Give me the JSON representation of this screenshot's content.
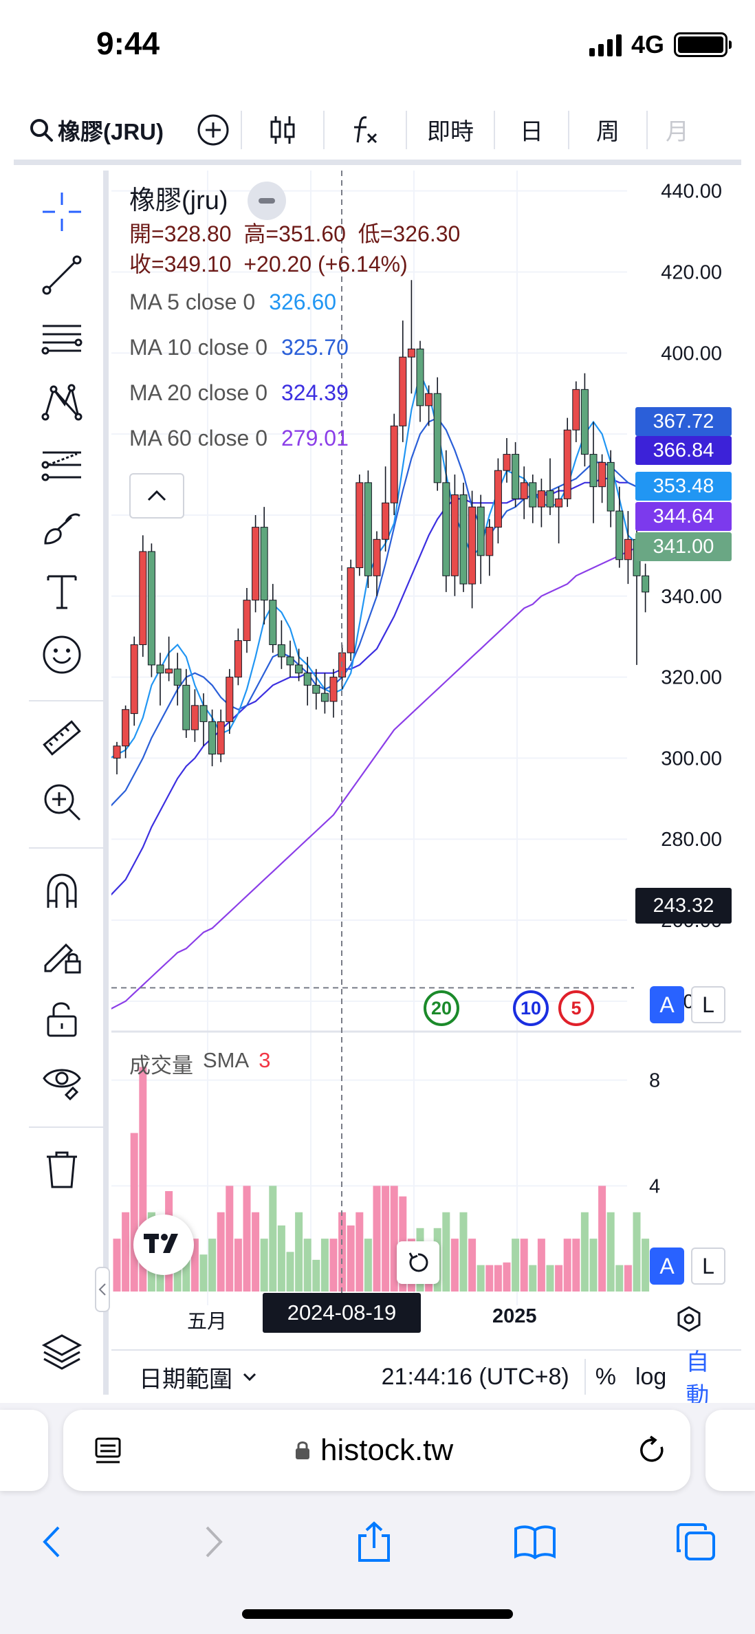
{
  "status_bar": {
    "time": "9:44",
    "network": "4G"
  },
  "toolbar": {
    "symbol": "橡膠(JRU)",
    "realtime_label": "即時",
    "day_label": "日",
    "week_label": "周",
    "month_label": "月"
  },
  "legend": {
    "title": "橡膠(jru)",
    "open_label": "開=",
    "open": "328.80",
    "high_label": "高=",
    "high": "351.60",
    "low_label": "低=",
    "low": "326.30",
    "close_label": "收=",
    "close": "349.10",
    "change": "+20.20 (+6.14%)",
    "ma": [
      {
        "name": "MA 5 close 0",
        "value": "326.60",
        "color": "#2196f3"
      },
      {
        "name": "MA 10 close 0",
        "value": "325.70",
        "color": "#2a5fd8"
      },
      {
        "name": "MA 20 close 0",
        "value": "324.39",
        "color": "#3c2fe0"
      },
      {
        "name": "MA 60 close 0",
        "value": "279.01",
        "color": "#8b3ee8"
      }
    ]
  },
  "price_tags": [
    {
      "value": "367.72",
      "color": "#2b5fd9"
    },
    {
      "value": "366.84",
      "color": "#3c22d8"
    },
    {
      "value": "353.48",
      "color": "#2196f3"
    },
    {
      "value": "344.64",
      "color": "#7c3aed"
    },
    {
      "value": "341.00",
      "color": "#6aa784"
    }
  ],
  "crosshair": {
    "price": "243.32",
    "date": "2024-08-19"
  },
  "scale_buttons": {
    "auto": "A",
    "log": "L"
  },
  "markers": [
    {
      "label": "20",
      "color": "#1b8a2a"
    },
    {
      "label": "10",
      "color": "#1a2ee0"
    },
    {
      "label": "5",
      "color": "#e0202a"
    }
  ],
  "volume_legend": {
    "name": "成交量",
    "type": "SMA",
    "length": "3"
  },
  "x_axis_labels": [
    "五月",
    "2025"
  ],
  "bottom_bar": {
    "date_range": "日期範圍",
    "clock": "21:44:16 (UTC+8)",
    "percent": "%",
    "log": "log",
    "auto": "自動"
  },
  "browser": {
    "url": "histock.tw"
  },
  "colors": {
    "up": "#e84b4b",
    "down": "#5fa67d",
    "vol_up": "#f48fb1",
    "vol_down": "#a5d6a7",
    "accent": "#2962ff"
  },
  "chart_data": {
    "type": "candlestick",
    "title": "橡膠(jru)",
    "price_axis": {
      "ticks": [
        440,
        420,
        400,
        380,
        360,
        340,
        320,
        300,
        280,
        260,
        240
      ],
      "ylim": [
        232,
        443
      ]
    },
    "volume_axis": {
      "ticks": [
        4,
        8
      ],
      "ylim": [
        0,
        9.5
      ]
    },
    "candles": [
      [
        300,
        304,
        296,
        303
      ],
      [
        303,
        313,
        300,
        312
      ],
      [
        311,
        330,
        308,
        328
      ],
      [
        328,
        355,
        325,
        351
      ],
      [
        351,
        353,
        320,
        323
      ],
      [
        323,
        326,
        313,
        321
      ],
      [
        321,
        330,
        319,
        322
      ],
      [
        322,
        326,
        313,
        318
      ],
      [
        318,
        322,
        305,
        307
      ],
      [
        307,
        317,
        304,
        313
      ],
      [
        313,
        316,
        303,
        309
      ],
      [
        309,
        312,
        298,
        301
      ],
      [
        301,
        312,
        299,
        309
      ],
      [
        309,
        322,
        306,
        320
      ],
      [
        320,
        332,
        318,
        329
      ],
      [
        329,
        342,
        326,
        339
      ],
      [
        339,
        360,
        336,
        357
      ],
      [
        357,
        362,
        333,
        339
      ],
      [
        339,
        343,
        326,
        328
      ],
      [
        328,
        334,
        322,
        325
      ],
      [
        325,
        329,
        320,
        323
      ],
      [
        323,
        327,
        319,
        321
      ],
      [
        321,
        325,
        313,
        318
      ],
      [
        318,
        322,
        312,
        316
      ],
      [
        316,
        321,
        311,
        314
      ],
      [
        314,
        322,
        310,
        320
      ],
      [
        320,
        328,
        317,
        326
      ],
      [
        326,
        349,
        324,
        347
      ],
      [
        347,
        370,
        345,
        368
      ],
      [
        368,
        371,
        342,
        345
      ],
      [
        345,
        356,
        340,
        354
      ],
      [
        354,
        372,
        351,
        363
      ],
      [
        363,
        385,
        360,
        382
      ],
      [
        382,
        408,
        378,
        399
      ],
      [
        399,
        418,
        390,
        401
      ],
      [
        401,
        403,
        383,
        387
      ],
      [
        387,
        392,
        382,
        390
      ],
      [
        390,
        394,
        366,
        368
      ],
      [
        368,
        376,
        341,
        345
      ],
      [
        345,
        370,
        340,
        365
      ],
      [
        365,
        368,
        341,
        343
      ],
      [
        343,
        366,
        337,
        362
      ],
      [
        362,
        365,
        343,
        350
      ],
      [
        350,
        359,
        345,
        357
      ],
      [
        357,
        374,
        353,
        371
      ],
      [
        371,
        379,
        368,
        375
      ],
      [
        375,
        378,
        362,
        364
      ],
      [
        364,
        372,
        359,
        368
      ],
      [
        368,
        370,
        358,
        362
      ],
      [
        362,
        369,
        357,
        366
      ],
      [
        366,
        374,
        360,
        362
      ],
      [
        362,
        367,
        353,
        364
      ],
      [
        364,
        384,
        362,
        381
      ],
      [
        381,
        393,
        378,
        391
      ],
      [
        391,
        395,
        372,
        375
      ],
      [
        375,
        383,
        358,
        367
      ],
      [
        367,
        375,
        363,
        373
      ],
      [
        373,
        376,
        357,
        361
      ],
      [
        361,
        367,
        347,
        349
      ],
      [
        349,
        361,
        343,
        354
      ],
      [
        354,
        357,
        323,
        345
      ],
      [
        345,
        348,
        336,
        341
      ]
    ],
    "volume": [
      2,
      3,
      6,
      8.5,
      3,
      2.2,
      3.8,
      2,
      1.5,
      2,
      1.4,
      2,
      3,
      4,
      2,
      4,
      3,
      2,
      4,
      2.5,
      1.5,
      3,
      2,
      1.2,
      2,
      2,
      3,
      2.5,
      3,
      2,
      4,
      4,
      4,
      3.6,
      2,
      2.4,
      1.8,
      2.4,
      3,
      2,
      3,
      2,
      1,
      1,
      1,
      1.1,
      2,
      2,
      1,
      2,
      1,
      1,
      2,
      2,
      3,
      2,
      4,
      3,
      1,
      1,
      3,
      2
    ],
    "ma_5": [
      300,
      302,
      305,
      310,
      318,
      322,
      326,
      328,
      325,
      318,
      313,
      310,
      306,
      307,
      311,
      317,
      325,
      334,
      338,
      336,
      332,
      325,
      323,
      320,
      317,
      316,
      317,
      321,
      333,
      345,
      350,
      353,
      358,
      372,
      386,
      395,
      390,
      381,
      370,
      360,
      355,
      350,
      352,
      360,
      366,
      371,
      370,
      369,
      366,
      363,
      362,
      363,
      367,
      374,
      380,
      383,
      380,
      373,
      364,
      355,
      353,
      353
    ],
    "ma_10": [
      288,
      292,
      296,
      300,
      305,
      309,
      313,
      317,
      320,
      321,
      320,
      318,
      315,
      313,
      312,
      313,
      317,
      321,
      325,
      326,
      325,
      323,
      321,
      318,
      317,
      318,
      320,
      323,
      328,
      334,
      340,
      348,
      357,
      366,
      374,
      380,
      383,
      384,
      381,
      376,
      370,
      362,
      357,
      355,
      358,
      361,
      362,
      364,
      365,
      365,
      366,
      367,
      368,
      369,
      371,
      373,
      373,
      372,
      370,
      368,
      367,
      366
    ],
    "ma_20": [
      266,
      270,
      274,
      278,
      283,
      287,
      291,
      295,
      298,
      300,
      303,
      305,
      307,
      309,
      311,
      313,
      314,
      316,
      318,
      319,
      320,
      320,
      321,
      321,
      321,
      321,
      322,
      322,
      323,
      325,
      327,
      331,
      335,
      340,
      345,
      350,
      355,
      359,
      362,
      364,
      364,
      363,
      363,
      363,
      363,
      363,
      364,
      364,
      365,
      365,
      365,
      366,
      366,
      367,
      368,
      368,
      369,
      369,
      368,
      368,
      367,
      366
    ],
    "ma_60": [
      238,
      240,
      242,
      244,
      246,
      248,
      250,
      252,
      253,
      255,
      257,
      258,
      260,
      262,
      264,
      266,
      268,
      270,
      272,
      274,
      276,
      278,
      280,
      282,
      284,
      286,
      289,
      292,
      295,
      298,
      301,
      304,
      307,
      309,
      311,
      313,
      315,
      317,
      319,
      321,
      323,
      325,
      327,
      329,
      331,
      333,
      335,
      337,
      338,
      340,
      341,
      342,
      343,
      345,
      346,
      347,
      348,
      349,
      350,
      351,
      352,
      353
    ]
  }
}
